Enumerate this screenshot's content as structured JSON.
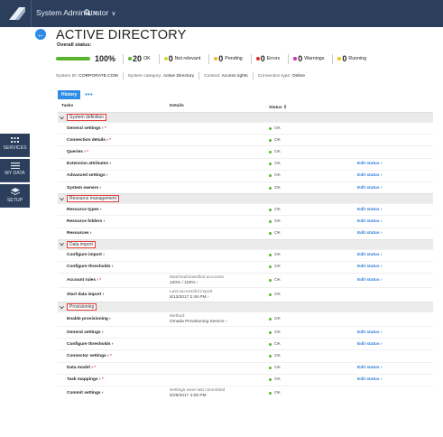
{
  "topbar": {
    "user_label": "System Administrator",
    "search_icon": "search-icon"
  },
  "leftnav": [
    {
      "label": "SERVICES",
      "icon": "grid-icon"
    },
    {
      "label": "MY DATA",
      "icon": "hamburger-icon"
    },
    {
      "label": "SETUP",
      "icon": "layers-icon"
    }
  ],
  "header": {
    "title": "ACTIVE DIRECTORY",
    "overall_label": "Overall status:"
  },
  "status": {
    "progress": 100,
    "percent_label": "100%",
    "counts": [
      {
        "num": "20",
        "label": "OK",
        "color": "#5ab42e"
      },
      {
        "num": "0",
        "label": "Not relevant",
        "color": "#d8d83a"
      },
      {
        "num": "0",
        "label": "Pending",
        "color": "#f0b832"
      },
      {
        "num": "0",
        "label": "Errors",
        "color": "#d92b2b"
      },
      {
        "num": "0",
        "label": "Warnings",
        "color": "#d62bc0"
      },
      {
        "num": "0",
        "label": "Running",
        "color": "#f0c400"
      }
    ]
  },
  "info": {
    "system_id_label": "System ID:",
    "system_id": "CORPORATE.COM",
    "category_label": "System category:",
    "category": "Active Directory",
    "context_label": "Context:",
    "context": "Access rights",
    "connection_label": "Connection type:",
    "connection": "Online"
  },
  "tabs": {
    "history": "History",
    "more": "•••"
  },
  "table": {
    "headers": {
      "tasks": "Tasks",
      "details": "Details",
      "status": "Status ⇧"
    },
    "groups": [
      {
        "title": "System definition",
        "rows": [
          {
            "task": "General settings ›",
            "star": true,
            "details": "",
            "status": "OK",
            "edit": ""
          },
          {
            "task": "Connection details ›",
            "star": true,
            "details": "",
            "status": "OK",
            "edit": ""
          },
          {
            "task": "Queries ›",
            "star": true,
            "details": "",
            "status": "OK",
            "edit": ""
          },
          {
            "task": "Extension attributes ›",
            "star": false,
            "details": "",
            "status": "OK",
            "edit": "Edit status ›"
          },
          {
            "task": "Advanced settings ›",
            "star": false,
            "details": "",
            "status": "OK",
            "edit": "Edit status ›"
          },
          {
            "task": "System owners ›",
            "star": false,
            "details": "",
            "status": "OK",
            "edit": "Edit status ›"
          }
        ]
      },
      {
        "title": "Resource management",
        "rows": [
          {
            "task": "Resource types ›",
            "star": false,
            "details": "",
            "status": "OK",
            "edit": "Edit status ›"
          },
          {
            "task": "Resource folders ›",
            "star": false,
            "details": "",
            "status": "OK",
            "edit": "Edit status ›"
          },
          {
            "task": "Resources ›",
            "star": false,
            "details": "",
            "status": "OK",
            "edit": "Edit status ›"
          }
        ]
      },
      {
        "title": "Data import",
        "rows": [
          {
            "task": "Configure import ›",
            "star": false,
            "details": "",
            "status": "OK",
            "edit": "Edit status ›"
          },
          {
            "task": "Configure thresholds ›",
            "star": false,
            "details": "",
            "status": "OK",
            "edit": "Edit status ›"
          },
          {
            "task": "Account rules ›",
            "star": true,
            "details": "Matched/classified accounts",
            "details2": "100% / 100% ›",
            "status": "OK",
            "edit": "Edit status ›"
          },
          {
            "task": "Start data import ›",
            "star": false,
            "details": "Last successful import",
            "details2": "6/13/2017 2:45 PM ›",
            "status": "OK",
            "edit": ""
          }
        ]
      },
      {
        "title": "Provisioning",
        "rows": [
          {
            "task": "Enable provisioning ›",
            "star": false,
            "details": "Method:",
            "details2": "Omada Provisioning Service ›",
            "status": "OK",
            "edit": ""
          },
          {
            "task": "General settings ›",
            "star": false,
            "details": "",
            "status": "OK",
            "edit": "Edit status ›"
          },
          {
            "task": "Configure thresholds ›",
            "star": false,
            "details": "",
            "status": "OK",
            "edit": "Edit status ›"
          },
          {
            "task": "Connector settings ›",
            "star": true,
            "details": "",
            "status": "OK",
            "edit": ""
          },
          {
            "task": "Data model ›",
            "star": true,
            "details": "",
            "status": "OK",
            "edit": "Edit status ›"
          },
          {
            "task": "Task mappings ›",
            "star": true,
            "details": "",
            "status": "OK",
            "edit": "Edit status ›"
          },
          {
            "task": "Commit settings ›",
            "star": false,
            "details": "Settings were last committed",
            "details2": "5/29/2017 4:09 PM",
            "status": "OK",
            "edit": ""
          }
        ]
      }
    ]
  }
}
